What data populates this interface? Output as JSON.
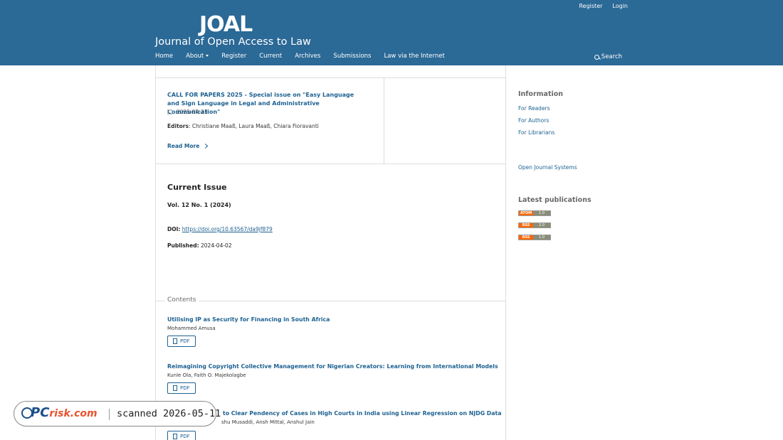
{
  "header": {
    "user_nav": [
      "Register",
      "Login"
    ],
    "logo_mark": "JOAL",
    "site_title": "Journal of Open Access to Law",
    "nav": [
      "Home",
      "About",
      "Register",
      "Current",
      "Archives",
      "Submissions",
      "Law via the Internet"
    ],
    "search_label": "Search"
  },
  "announcement": {
    "title": "CALL FOR PAPERS 2025  - Special issue on \"Easy Language and Sign Language in Legal and Administrative Communication\"",
    "date": "2025-04-23",
    "editors_label": "Editors",
    "editors": ": Christiane Maaß, Laura Maaß, Chiara Fioravanti",
    "read_more": "Read More"
  },
  "current_issue": {
    "heading": "Current Issue",
    "volume": "Vol. 12 No. 1 (2024)",
    "doi_label": "DOI:",
    "doi_url": "https://doi.org/10.63567/da9jf879",
    "published_label": "Published:",
    "published_date": "2024-04-02"
  },
  "contents": {
    "label": "Contents",
    "articles": [
      {
        "title": "Utilising IP as Security for Financing in South Africa",
        "authors": "Mohammed Amusa",
        "pdf": "PDF"
      },
      {
        "title": "Reimagining Copyright Collective Management for Nigerian Creators: Learning from International Models",
        "authors": "Kunle Ola, Faith O. Majekolagbe",
        "pdf": "PDF"
      },
      {
        "title": "to Clear Pendency of Cases in High Courts in India using Linear Regression on NJDG Data",
        "authors": "shu Musaddi, Ansh Mittal, Anshul Jain",
        "pdf": "PDF"
      }
    ]
  },
  "sidebar": {
    "information_heading": "Information",
    "information_links": [
      "For Readers",
      "For Authors",
      "For Librarians"
    ],
    "ojs_link": "Open Journal Systems",
    "latest_heading": "Latest publications",
    "feeds": [
      {
        "left": "ATOM",
        "right": "1.0"
      },
      {
        "left": "RSS",
        "right": "2.0"
      },
      {
        "left": "RSS",
        "right": "1.0"
      }
    ]
  },
  "watermark": {
    "brand_main": "PC",
    "brand_sub": "risk.com",
    "scan_text": "scanned 2026-05-11"
  }
}
